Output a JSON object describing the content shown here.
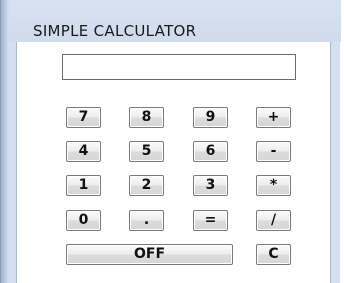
{
  "window": {
    "title": "SIMPLE CALCULATOR"
  },
  "display": {
    "value": ""
  },
  "keys": {
    "row1": [
      "7",
      "8",
      "9",
      "+"
    ],
    "row2": [
      "4",
      "5",
      "6",
      "-"
    ],
    "row3": [
      "1",
      "2",
      "3",
      "*"
    ],
    "row4": [
      "0",
      ".",
      "=",
      "/"
    ],
    "off": "OFF",
    "clear": "C"
  },
  "colors": {
    "frame": "#d5dfee",
    "client": "#ffffff",
    "key_face": "#e6e6e6",
    "key_border": "#7a7a7a"
  }
}
